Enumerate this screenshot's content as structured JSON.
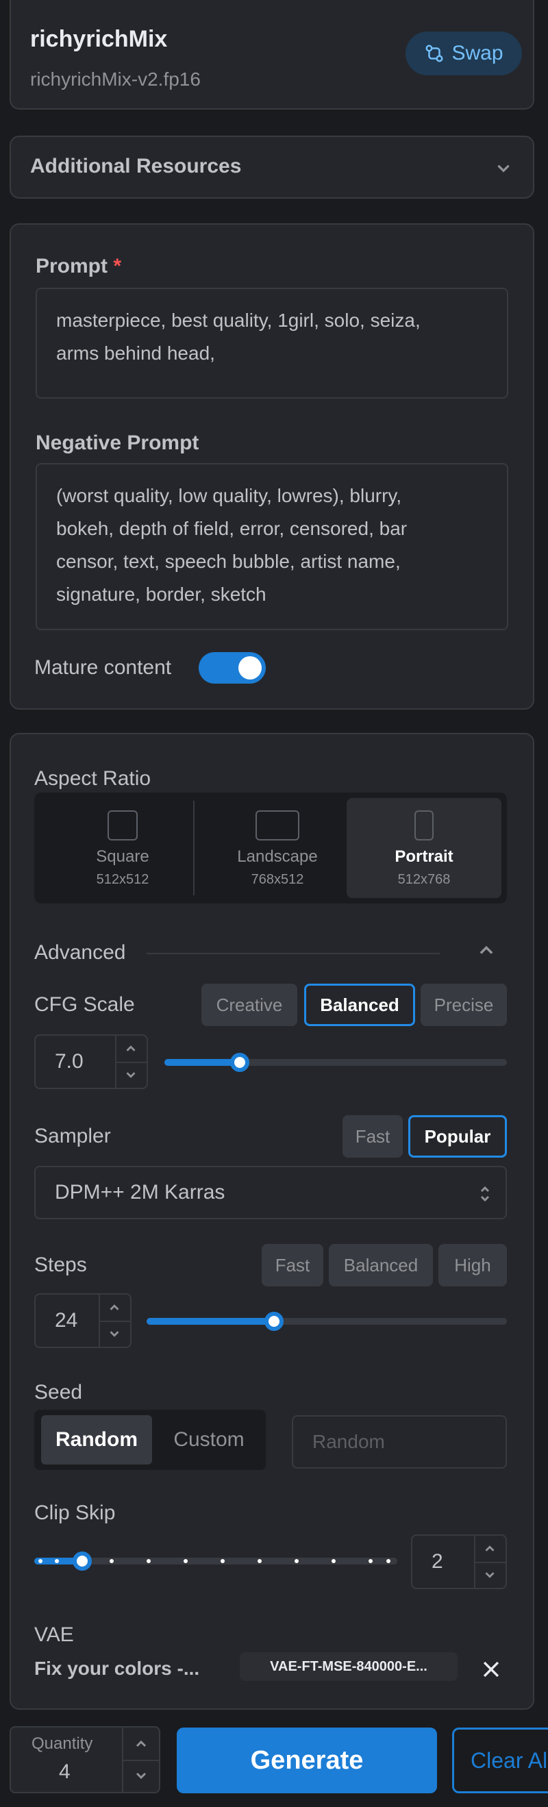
{
  "model": {
    "name": "richyrichMix",
    "version": "richyrichMix-v2.fp16",
    "swap_label": "Swap"
  },
  "additional_resources": {
    "label": "Additional Resources"
  },
  "prompt": {
    "label": "Prompt",
    "required_mark": "*",
    "value_line1": "masterpiece, best quality, 1girl, solo, seiza,",
    "value_line2": "arms behind head,"
  },
  "negative_prompt": {
    "label": "Negative Prompt",
    "line1": "(worst quality, low quality, lowres), blurry,",
    "line2": "bokeh, depth of field, error, censored, bar",
    "line3": "censor, text, speech bubble, artist name,",
    "line4": "signature, border, sketch"
  },
  "mature": {
    "label": "Mature content",
    "enabled": true
  },
  "aspect_ratio": {
    "label": "Aspect Ratio",
    "options": [
      {
        "name": "Square",
        "size": "512x512"
      },
      {
        "name": "Landscape",
        "size": "768x512"
      },
      {
        "name": "Portrait",
        "size": "512x768"
      }
    ],
    "selected": "Portrait"
  },
  "advanced": {
    "label": "Advanced"
  },
  "cfg": {
    "label": "CFG Scale",
    "presets": [
      "Creative",
      "Balanced",
      "Precise"
    ],
    "selected": "Balanced",
    "value": "7.0",
    "slider_fraction": 0.22
  },
  "sampler": {
    "label": "Sampler",
    "presets": [
      "Fast",
      "Popular"
    ],
    "selected": "Popular",
    "value": "DPM++ 2M Karras"
  },
  "steps": {
    "label": "Steps",
    "presets": [
      "Fast",
      "Balanced",
      "High"
    ],
    "value": "24",
    "slider_fraction": 0.35
  },
  "seed": {
    "label": "Seed",
    "options": [
      "Random",
      "Custom"
    ],
    "selected": "Random",
    "placeholder": "Random"
  },
  "clip_skip": {
    "label": "Clip Skip",
    "value": "2",
    "slider_fraction": 0.1
  },
  "vae": {
    "label": "VAE",
    "name": "Fix your colors -...",
    "badge": "VAE-FT-MSE-840000-E..."
  },
  "quantity": {
    "label": "Quantity",
    "value": "4"
  },
  "actions": {
    "generate": "Generate",
    "clear": "Clear All"
  },
  "colors": {
    "accent": "#1c7ed6",
    "background": "#1a1b1e",
    "card": "#25262b",
    "required": "#fa5252"
  }
}
